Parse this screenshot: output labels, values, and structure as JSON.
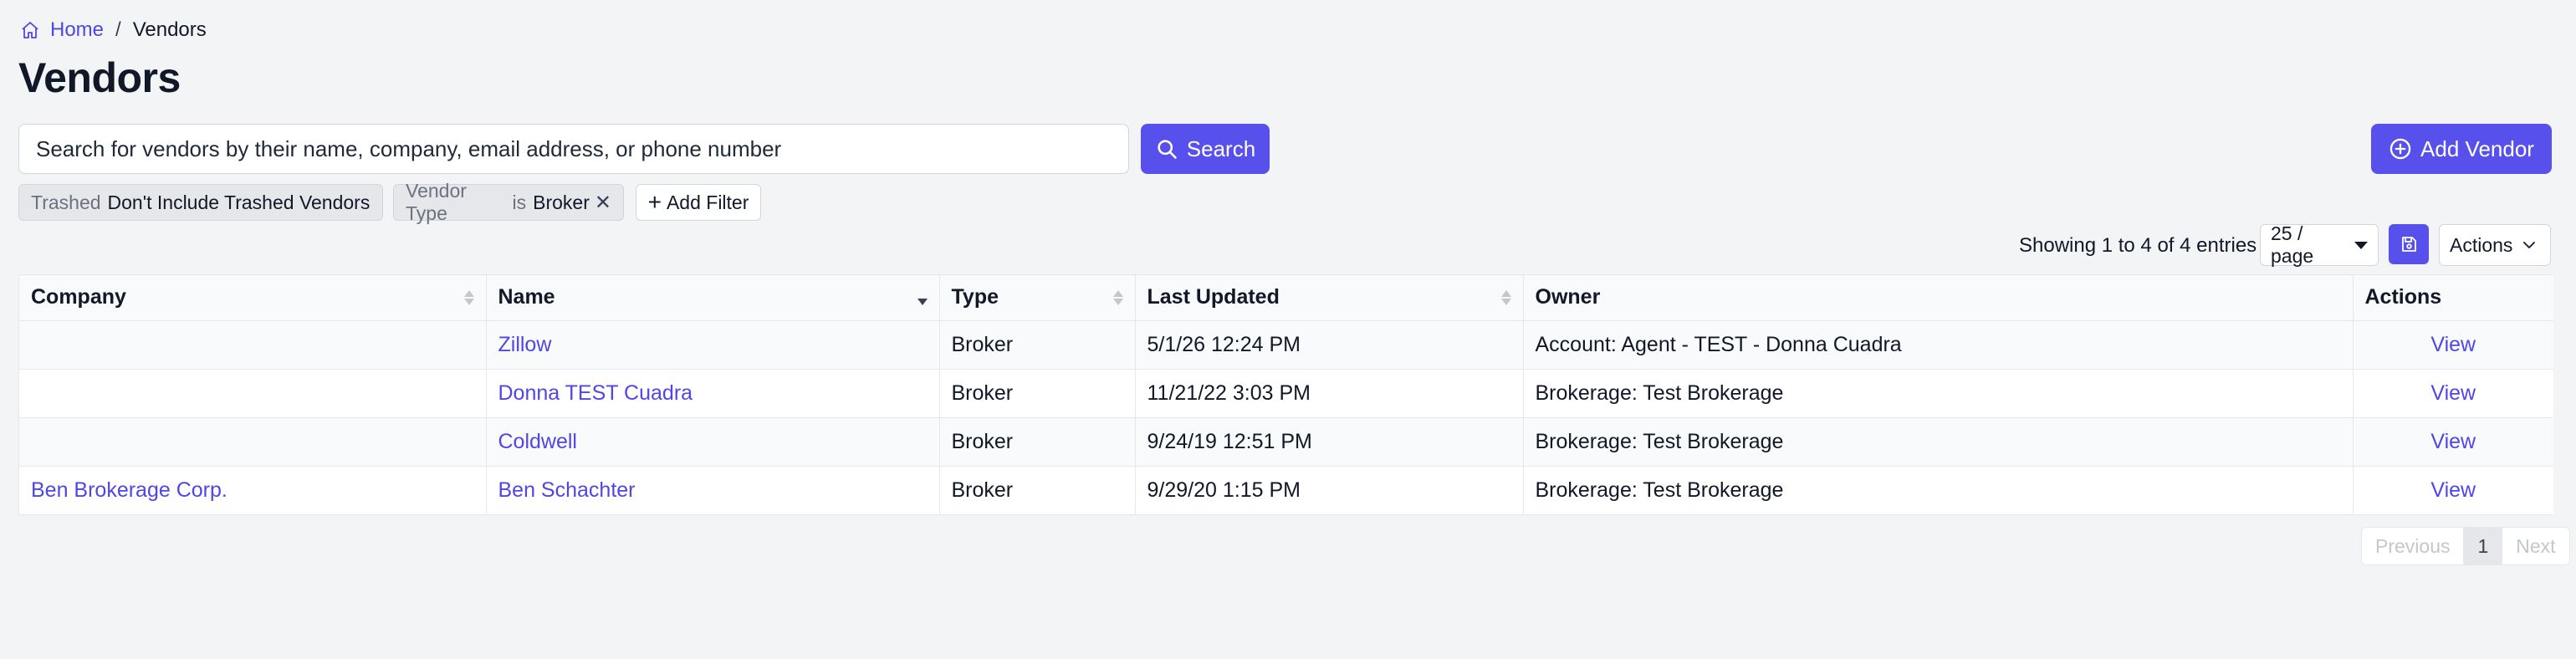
{
  "breadcrumb": {
    "home": "Home",
    "separator": "/",
    "current": "Vendors"
  },
  "page": {
    "title": "Vendors"
  },
  "search": {
    "placeholder": "Search for vendors by their name, company, email address, or phone number",
    "button_label": "Search"
  },
  "add_vendor": {
    "label": "Add Vendor"
  },
  "filters": {
    "trashed": {
      "key": "Trashed",
      "value": "Don't Include Trashed Vendors"
    },
    "vendor_type": {
      "key": "Vendor Type",
      "operator": "is",
      "value": "Broker",
      "remove": "✕"
    },
    "add_label": "Add Filter"
  },
  "table_controls": {
    "entries": "Showing 1 to 4 of 4 entries",
    "page_size": "25 / page",
    "actions_label": "Actions"
  },
  "table": {
    "headers": {
      "company": "Company",
      "name": "Name",
      "type": "Type",
      "last_updated": "Last Updated",
      "owner": "Owner",
      "actions": "Actions"
    },
    "rows": [
      {
        "company": "",
        "name": "Zillow",
        "type": "Broker",
        "last_updated": "5/1/26 12:24 PM",
        "owner": "Account: Agent - TEST - Donna Cuadra",
        "action": "View"
      },
      {
        "company": "",
        "name": "Donna TEST Cuadra",
        "type": "Broker",
        "last_updated": "11/21/22 3:03 PM",
        "owner": "Brokerage: Test Brokerage",
        "action": "View"
      },
      {
        "company": "",
        "name": "Coldwell",
        "type": "Broker",
        "last_updated": "9/24/19 12:51 PM",
        "owner": "Brokerage: Test Brokerage",
        "action": "View"
      },
      {
        "company": "Ben Brokerage Corp.",
        "name": "Ben Schachter",
        "type": "Broker",
        "last_updated": "9/29/20 1:15 PM",
        "owner": "Brokerage: Test Brokerage",
        "action": "View"
      }
    ]
  },
  "pagination": {
    "previous": "Previous",
    "current": "1",
    "next": "Next"
  },
  "colors": {
    "primary": "#5850ec",
    "link": "#4f46e5",
    "background": "#f3f4f6"
  },
  "icons": {
    "home": "home-icon",
    "search": "search-icon",
    "add": "plus-circle-icon",
    "save": "save-icon",
    "chevron": "chevron-down-icon"
  }
}
